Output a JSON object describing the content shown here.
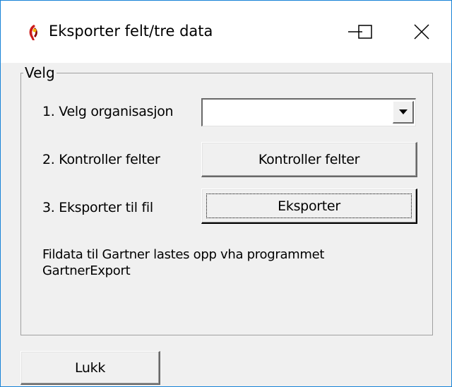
{
  "window": {
    "title": "Eksporter felt/tre data",
    "app_icon": "torch-icon",
    "controls": {
      "minimize": "minimize-icon",
      "maximize": "maximize-icon",
      "close": "close-icon"
    }
  },
  "group": {
    "legend": "Velg",
    "steps": [
      {
        "label": "1. Velg organisasjon"
      },
      {
        "label": "2. Kontroller felter"
      },
      {
        "label": "3. Eksporter til fil"
      }
    ],
    "organisation_select": {
      "value": "",
      "arrow_icon": "chevron-down-icon"
    },
    "kontroller_button": "Kontroller felter",
    "eksporter_button": "Eksporter",
    "info_lines": [
      "Fildata til Gartner lastes opp vha programmet",
      "GartnerExport"
    ]
  },
  "footer": {
    "close_button": "Lukk"
  }
}
